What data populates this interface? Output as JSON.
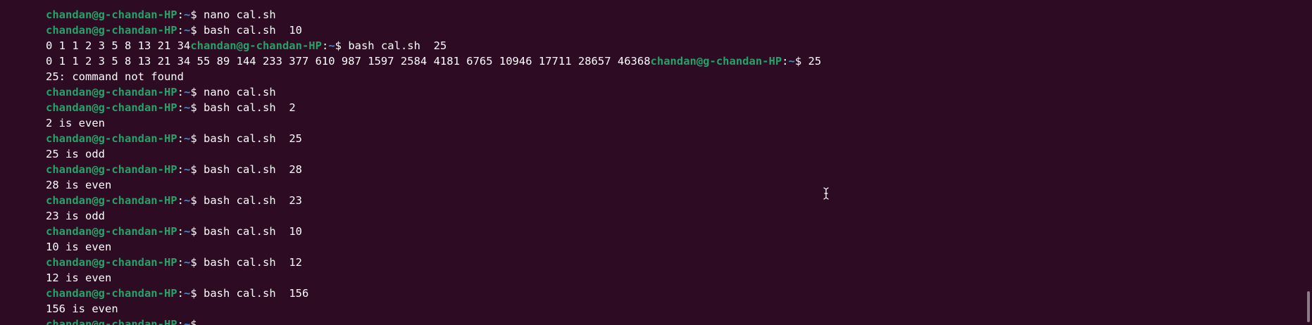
{
  "terminal": {
    "background": "#2c0b23",
    "user_color": "#26a269",
    "path_color": "#3f8ddb",
    "lines": [
      {
        "kind": "prompt",
        "user": "chandan@g-chandan-HP",
        "sep": ":",
        "path": "~",
        "dollar": "$",
        "cmd": " nano cal.sh"
      },
      {
        "kind": "prompt",
        "user": "chandan@g-chandan-HP",
        "sep": ":",
        "path": "~",
        "dollar": "$",
        "cmd": " bash cal.sh  10"
      },
      {
        "kind": "mixed",
        "text": "0 1 1 2 3 5 8 13 21 34",
        "user": "chandan@g-chandan-HP",
        "sep": ":",
        "path": "~",
        "dollar": "$",
        "cmd": " bash cal.sh  25"
      },
      {
        "kind": "mixed",
        "text": "0 1 1 2 3 5 8 13 21 34 55 89 144 233 377 610 987 1597 2584 4181 6765 10946 17711 28657 46368",
        "user": "chandan@g-chandan-HP",
        "sep": ":",
        "path": "~",
        "dollar": "$",
        "cmd": " 25"
      },
      {
        "kind": "output",
        "text": "25: command not found"
      },
      {
        "kind": "prompt",
        "user": "chandan@g-chandan-HP",
        "sep": ":",
        "path": "~",
        "dollar": "$",
        "cmd": " nano cal.sh"
      },
      {
        "kind": "prompt",
        "user": "chandan@g-chandan-HP",
        "sep": ":",
        "path": "~",
        "dollar": "$",
        "cmd": " bash cal.sh  2"
      },
      {
        "kind": "output",
        "text": "2 is even"
      },
      {
        "kind": "prompt",
        "user": "chandan@g-chandan-HP",
        "sep": ":",
        "path": "~",
        "dollar": "$",
        "cmd": " bash cal.sh  25"
      },
      {
        "kind": "output",
        "text": "25 is odd"
      },
      {
        "kind": "prompt",
        "user": "chandan@g-chandan-HP",
        "sep": ":",
        "path": "~",
        "dollar": "$",
        "cmd": " bash cal.sh  28"
      },
      {
        "kind": "output",
        "text": "28 is even"
      },
      {
        "kind": "prompt",
        "user": "chandan@g-chandan-HP",
        "sep": ":",
        "path": "~",
        "dollar": "$",
        "cmd": " bash cal.sh  23"
      },
      {
        "kind": "output",
        "text": "23 is odd"
      },
      {
        "kind": "prompt",
        "user": "chandan@g-chandan-HP",
        "sep": ":",
        "path": "~",
        "dollar": "$",
        "cmd": " bash cal.sh  10"
      },
      {
        "kind": "output",
        "text": "10 is even"
      },
      {
        "kind": "prompt",
        "user": "chandan@g-chandan-HP",
        "sep": ":",
        "path": "~",
        "dollar": "$",
        "cmd": " bash cal.sh  12"
      },
      {
        "kind": "output",
        "text": "12 is even"
      },
      {
        "kind": "prompt",
        "user": "chandan@g-chandan-HP",
        "sep": ":",
        "path": "~",
        "dollar": "$",
        "cmd": " bash cal.sh  156"
      },
      {
        "kind": "output",
        "text": "156 is even"
      },
      {
        "kind": "prompt",
        "user": "chandan@g-chandan-HP",
        "sep": ":",
        "path": "~",
        "dollar": "$",
        "cmd": " "
      }
    ]
  },
  "icons": {
    "text_cursor": "i-beam-cursor-icon",
    "scrollbar": "scrollbar-thumb"
  }
}
